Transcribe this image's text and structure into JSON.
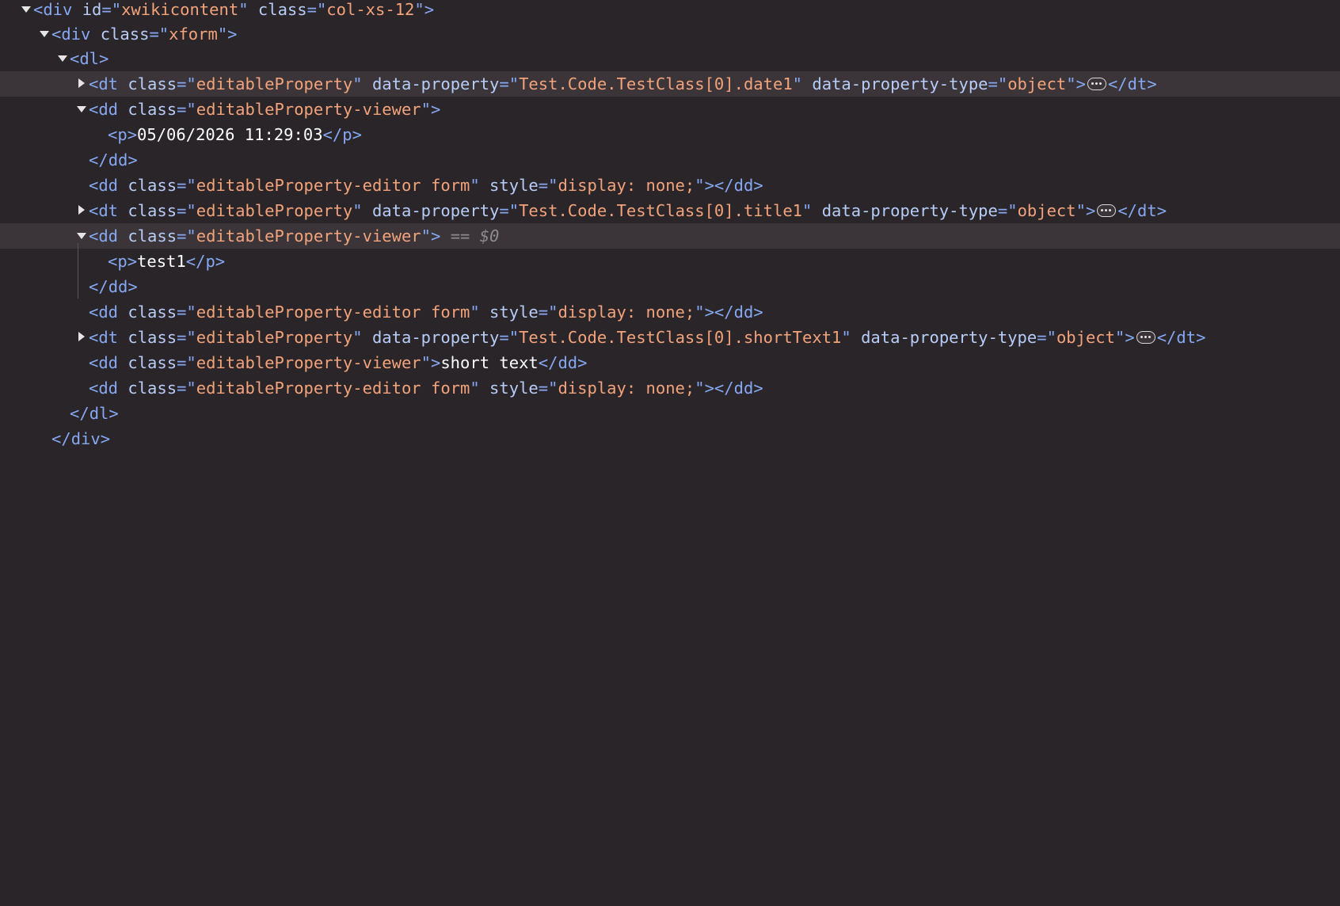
{
  "nodes": {
    "xwikicontent_open": {
      "tag": "div",
      "attr1": "id",
      "val1": "xwikicontent",
      "attr2": "class",
      "val2": "col-xs-12"
    },
    "xform_open": {
      "tag": "div",
      "attr1": "class",
      "val1": "xform"
    },
    "dl_open": {
      "tag": "dl"
    },
    "dt_date": {
      "tag": "dt",
      "attr_class": "class",
      "val_class": "editableProperty",
      "attr_prop": "data-property",
      "val_prop": "Test.Code.TestClass[0].date1",
      "attr_type": "data-property-type",
      "val_type": "object",
      "close": "dt"
    },
    "dd_viewer_date": {
      "tag": "dd",
      "attr1": "class",
      "val1": "editableProperty-viewer"
    },
    "p_date": {
      "tag": "p",
      "text": "05/06/2026 11:29:03",
      "close": "p"
    },
    "dd_viewer_date_close": {
      "close": "dd"
    },
    "dd_editor_date": {
      "tag": "dd",
      "attr1": "class",
      "val1": "editableProperty-editor form",
      "attr2": "style",
      "val2": "display: none;",
      "close": "dd"
    },
    "dt_title": {
      "tag": "dt",
      "attr_class": "class",
      "val_class": "editableProperty",
      "attr_prop": "data-property",
      "val_prop": "Test.Code.TestClass[0].title1",
      "attr_type": "data-property-type",
      "val_type": "object",
      "close": "dt"
    },
    "dd_viewer_title": {
      "tag": "dd",
      "attr1": "class",
      "val1": "editableProperty-viewer",
      "ref": "== $0"
    },
    "p_title": {
      "tag": "p",
      "text": "test1",
      "close": "p"
    },
    "dd_viewer_title_close": {
      "close": "dd"
    },
    "dd_editor_title": {
      "tag": "dd",
      "attr1": "class",
      "val1": "editableProperty-editor form",
      "attr2": "style",
      "val2": "display: none;",
      "close": "dd"
    },
    "dt_short": {
      "tag": "dt",
      "attr_class": "class",
      "val_class": "editableProperty",
      "attr_prop": "data-property",
      "val_prop": "Test.Code.TestClass[0].shortText1",
      "attr_type": "data-property-type",
      "val_type": "object",
      "close": "dt"
    },
    "dd_viewer_short": {
      "tag": "dd",
      "attr1": "class",
      "val1": "editableProperty-viewer",
      "text": "short text",
      "close": "dd"
    },
    "dd_editor_short": {
      "tag": "dd",
      "attr1": "class",
      "val1": "editableProperty-editor form",
      "attr2": "style",
      "val2": "display: none;",
      "close": "dd"
    },
    "dl_close": {
      "close": "dl"
    },
    "div_close": {
      "close": "div"
    }
  },
  "icons": {
    "expanded": "triangle-down-icon",
    "collapsed": "triangle-right-icon",
    "ellipsis": "ellipsis-badge-icon"
  },
  "colors": {
    "background": "#2a2529",
    "selected_row": "#3b3539",
    "tag": "#86a8f2",
    "attribute": "#b7cdf7",
    "value": "#f3a37b",
    "text": "#ffffff"
  }
}
